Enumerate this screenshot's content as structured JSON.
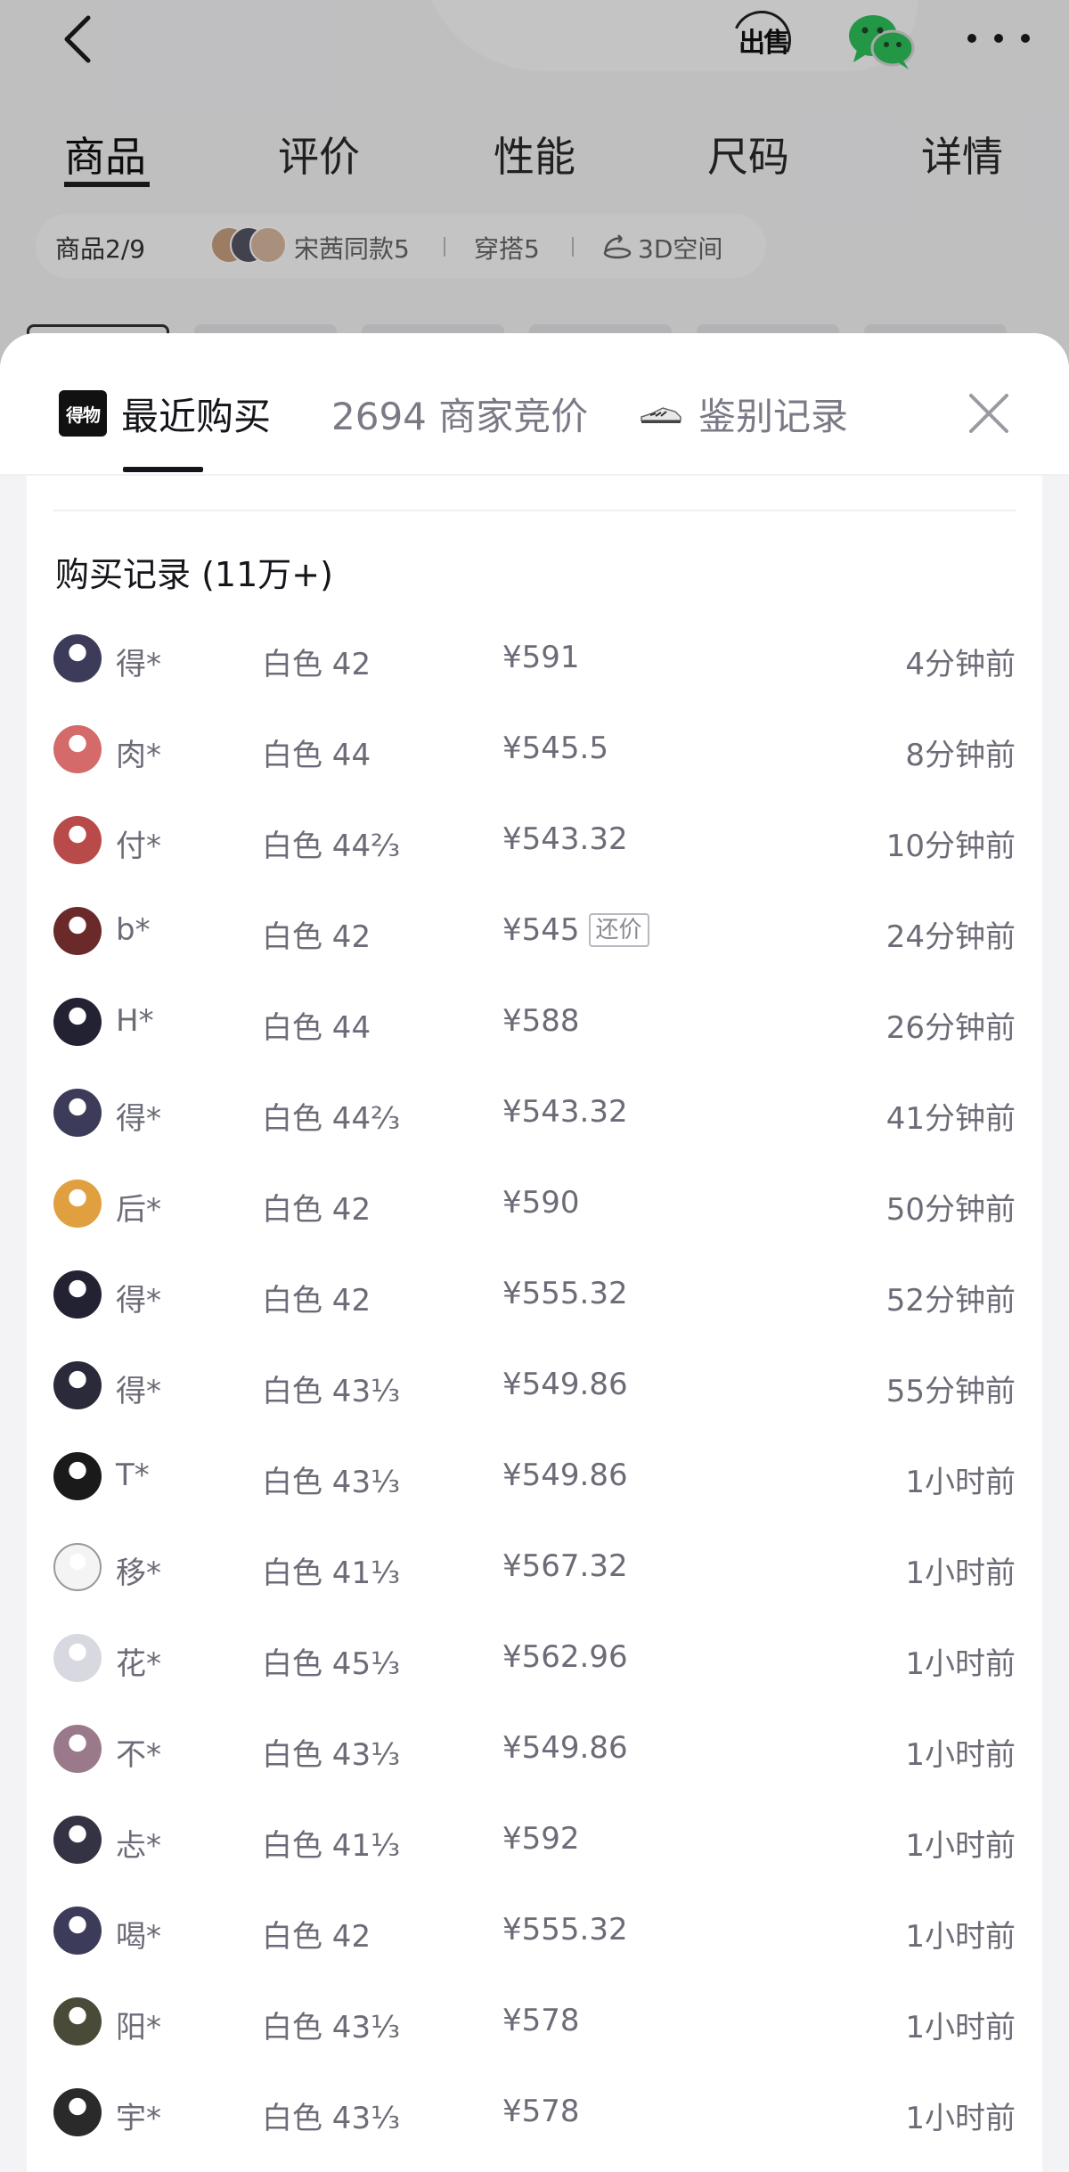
{
  "background": {
    "product_tabs": [
      {
        "label": "商品"
      },
      {
        "label": "评价"
      },
      {
        "label": "性能"
      },
      {
        "label": "尺码"
      },
      {
        "label": "详情"
      }
    ],
    "sub_bar": {
      "position": "商品2/9",
      "same_style": "宋茜同款5",
      "outfit": "穿搭5",
      "space_3d": "3D空间"
    },
    "sell_label": "出售"
  },
  "sheet": {
    "tabs": {
      "recent": "最近购买",
      "bids": "2694 商家竞价",
      "auth": "鉴别记录"
    },
    "section_title": "购买记录 (11万+)",
    "records": [
      {
        "name": "得*",
        "size": "白色 42",
        "price": "¥591",
        "tag": "",
        "time": "4分钟前",
        "avatar_color": "#3c3c5a"
      },
      {
        "name": "肉*",
        "size": "白色 44",
        "price": "¥545.5",
        "tag": "",
        "time": "8分钟前",
        "avatar_color": "#d46a6a"
      },
      {
        "name": "付*",
        "size": "白色 44⅔",
        "price": "¥543.32",
        "tag": "",
        "time": "10分钟前",
        "avatar_color": "#b84a4a"
      },
      {
        "name": "b*",
        "size": "白色 42",
        "price": "¥545",
        "tag": "还价",
        "time": "24分钟前",
        "avatar_color": "#6b2a2a"
      },
      {
        "name": "H*",
        "size": "白色 44",
        "price": "¥588",
        "tag": "",
        "time": "26分钟前",
        "avatar_color": "#222233"
      },
      {
        "name": "得*",
        "size": "白色 44⅔",
        "price": "¥543.32",
        "tag": "",
        "time": "41分钟前",
        "avatar_color": "#3c3c5a"
      },
      {
        "name": "后*",
        "size": "白色 42",
        "price": "¥590",
        "tag": "",
        "time": "50分钟前",
        "avatar_color": "#e0a040"
      },
      {
        "name": "得*",
        "size": "白色 42",
        "price": "¥555.32",
        "tag": "",
        "time": "52分钟前",
        "avatar_color": "#222233"
      },
      {
        "name": "得*",
        "size": "白色 43⅓",
        "price": "¥549.86",
        "tag": "",
        "time": "55分钟前",
        "avatar_color": "#2a2a3a"
      },
      {
        "name": "T*",
        "size": "白色 43⅓",
        "price": "¥549.86",
        "tag": "",
        "time": "1小时前",
        "avatar_color": "#1a1a1a"
      },
      {
        "name": "移*",
        "size": "白色 41⅓",
        "price": "¥567.32",
        "tag": "",
        "time": "1小时前",
        "avatar_color": "#f4f4f4"
      },
      {
        "name": "花*",
        "size": "白色 45⅓",
        "price": "¥562.96",
        "tag": "",
        "time": "1小时前",
        "avatar_color": "#d8d8e0"
      },
      {
        "name": "不*",
        "size": "白色 43⅓",
        "price": "¥549.86",
        "tag": "",
        "time": "1小时前",
        "avatar_color": "#9a7a8a"
      },
      {
        "name": "忐*",
        "size": "白色 41⅓",
        "price": "¥592",
        "tag": "",
        "time": "1小时前",
        "avatar_color": "#333344"
      },
      {
        "name": "喝*",
        "size": "白色 42",
        "price": "¥555.32",
        "tag": "",
        "time": "1小时前",
        "avatar_color": "#3c3c5a"
      },
      {
        "name": "阳*",
        "size": "白色 43⅓",
        "price": "¥578",
        "tag": "",
        "time": "1小时前",
        "avatar_color": "#4a4a38"
      },
      {
        "name": "宇*",
        "size": "白色 43⅓",
        "price": "¥578",
        "tag": "",
        "time": "1小时前",
        "avatar_color": "#2a2a2a"
      }
    ]
  }
}
